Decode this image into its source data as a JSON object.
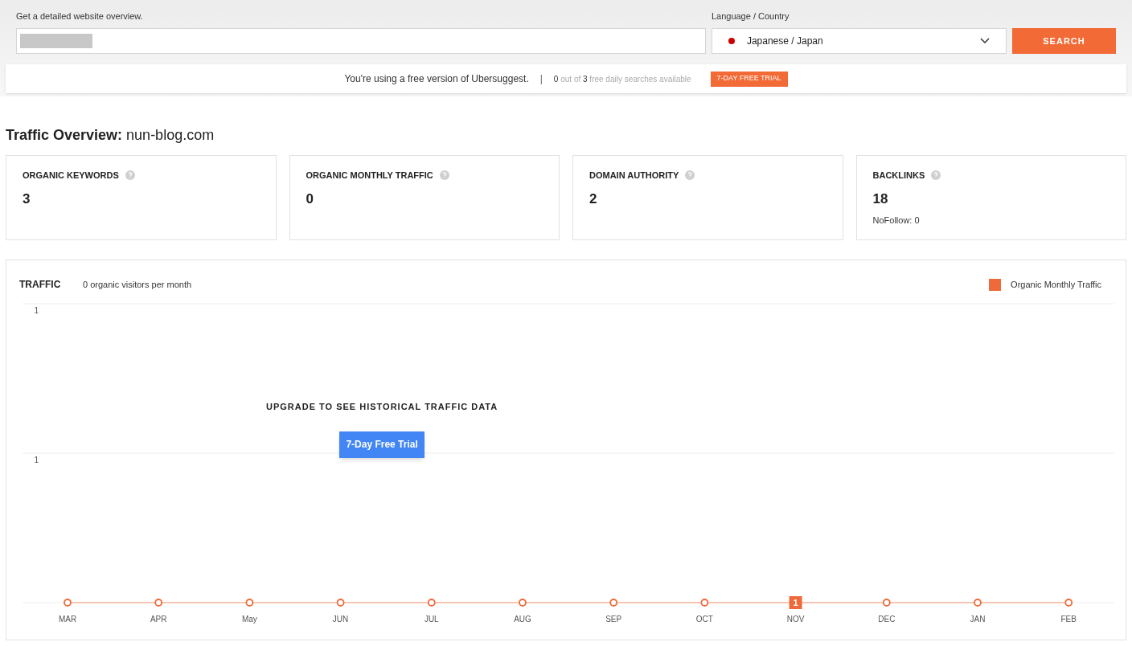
{
  "search_bar": {
    "url_label": "Get a detailed website overview.",
    "language_label": "Language / Country",
    "language_value": "Japanese / Japan",
    "search_button": "SEARCH"
  },
  "banner": {
    "message": "You're using a free version of Ubersuggest.",
    "separator": "|",
    "used": "0",
    "out_of": "out of",
    "limit": "3",
    "suffix": "free daily searches available",
    "trial_button": "7-DAY FREE TRIAL"
  },
  "title": {
    "label": "Traffic Overview:",
    "domain": "nun-blog.com"
  },
  "metrics": [
    {
      "label": "ORGANIC KEYWORDS",
      "value": "3"
    },
    {
      "label": "ORGANIC MONTHLY TRAFFIC",
      "value": "0"
    },
    {
      "label": "DOMAIN AUTHORITY",
      "value": "2"
    },
    {
      "label": "BACKLINKS",
      "value": "18",
      "note": "NoFollow: 0"
    }
  ],
  "traffic": {
    "heading": "TRAFFIC",
    "summary": "0 organic visitors per month",
    "legend": {
      "label": "Organic Monthly Traffic",
      "color": "#ef6a3a"
    },
    "y_axis_labels": [
      "1",
      "1"
    ],
    "months": [
      {
        "label": "MAR"
      },
      {
        "label": "APR"
      },
      {
        "label": "May"
      },
      {
        "label": "JUN"
      },
      {
        "label": "JUL"
      },
      {
        "label": "AUG"
      },
      {
        "label": "SEP"
      },
      {
        "label": "OCT"
      },
      {
        "label": "NOV",
        "point_label": "1"
      },
      {
        "label": "DEC"
      },
      {
        "label": "JAN"
      },
      {
        "label": "FEB"
      }
    ],
    "upgrade_message": "UPGRADE TO SEE HISTORICAL TRAFFIC DATA",
    "trial_button": "7-Day Free Trial"
  }
}
